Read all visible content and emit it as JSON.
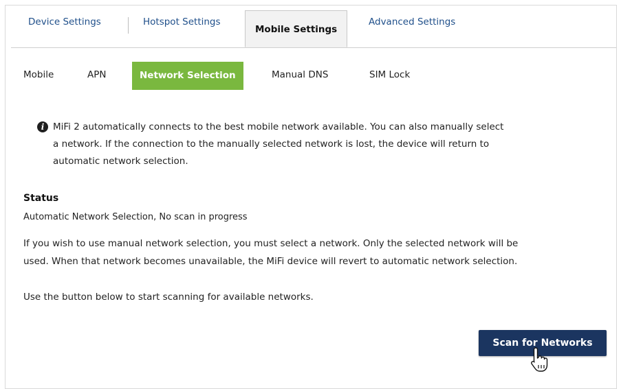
{
  "top_tabs": {
    "device": "Device Settings",
    "hotspot": "Hotspot Settings",
    "mobile": "Mobile Settings",
    "advanced": "Advanced Settings"
  },
  "sub_tabs": {
    "mobile": "Mobile",
    "apn": "APN",
    "network_selection": "Network Selection",
    "manual_dns": "Manual DNS",
    "sim_lock": "SIM Lock"
  },
  "info": {
    "icon": "info-icon",
    "lines": [
      "MiFi 2 automatically connects to the best mobile network available. You can also manually select",
      "a network. If the connection to the manually selected network is lost, the device will return to",
      "automatic network selection."
    ]
  },
  "status": {
    "heading": "Status",
    "value": "Automatic Network Selection, No scan in progress"
  },
  "manual_note": {
    "lines": [
      "If you wish to use manual network selection, you must select a network. Only the selected network will be",
      "used. When that network becomes unavailable, the MiFi device will revert to automatic network selection."
    ]
  },
  "scan_hint": "Use the button below to start scanning for available networks.",
  "scan_button": "Scan for Networks",
  "colors": {
    "active_subtab": "#7ab83f",
    "button": "#1b3560",
    "tab_link": "#1f4f8a"
  }
}
